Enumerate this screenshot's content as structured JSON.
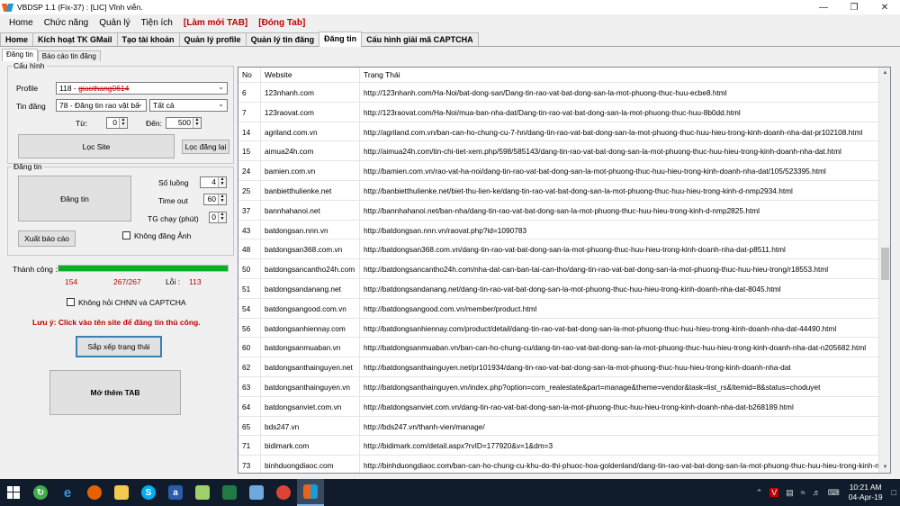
{
  "window": {
    "title": "VBDSP 1.1 (Fix-37) : [LIC] Vĩnh viễn."
  },
  "menu": [
    "Home",
    "Chức năng",
    "Quản lý",
    "Tiện ích"
  ],
  "menu_red": [
    "[Làm mới TAB]",
    "[Đóng Tab]"
  ],
  "top_tabs": [
    "Home",
    "Kích hoạt TK GMail",
    "Tạo tài khoản",
    "Quản lý profile",
    "Quản lý tin đăng",
    "Đăng tin",
    "Cấu hình giải mã CAPTCHA"
  ],
  "sub_tabs": [
    "Đăng tin",
    "Báo cáo tin đăng"
  ],
  "config": {
    "legend": "Cấu hình",
    "profile_label": "Profile",
    "profile_id": "118 -",
    "profile_name": "giaothang0614",
    "tin_dang_label": "Tin đăng",
    "tin_dang_value": "78 - Đăng tin rao vặt bấ",
    "filter_value": "Tất cả",
    "tu_label": "Từ:",
    "tu_value": "0",
    "den_label": "Đến:",
    "den_value": "500",
    "loc_site": "Lọc Site",
    "loc_dang_lai": "Lọc đăng lại"
  },
  "post": {
    "legend": "Đăng tin",
    "button": "Đăng tin",
    "so_luong_label": "Số luồng",
    "so_luong": "4",
    "timeout_label": "Time out",
    "timeout": "60",
    "tg_chay_label": "TG chạy (phút)",
    "tg_chay": "0",
    "xuat_bao_cao": "Xuất báo cáo",
    "khong_dang_anh": "Không đăng Ảnh"
  },
  "status": {
    "thanh_cong_label": "Thành công :",
    "progress": 1.0,
    "success": "154",
    "count": "267/267",
    "loi_label": "Lỗi :",
    "loi": "113",
    "khong_hoi": "Không hỏi CHNN và CAPTCHA",
    "luu_y": "Lưu ý: Click vào tên site để đăng tin thủ công.",
    "sap_xep": "Sắp xếp trạng thái",
    "mo_them_tab": "Mở thêm TAB"
  },
  "grid": {
    "columns": [
      "No",
      "Website",
      "Trạng Thái"
    ],
    "rows": [
      [
        "6",
        "123nhanh.com",
        "http://123nhanh.com/Ha-Noi/bat-dong-san/Dang-tin-rao-vat-bat-dong-san-la-mot-phuong-thuc-huu-ecbe8.html"
      ],
      [
        "7",
        "123raovat.com",
        "http://123raovat.com/Ha-Noi/mua-ban-nha-dat/Dang-tin-rao-vat-bat-dong-san-la-mot-phuong-thuc-huu-8b0dd.html"
      ],
      [
        "14",
        "agriland.com.vn",
        "http://agriland.com.vn/ban-can-ho-chung-cu-7-hn/dang-tin-rao-vat-bat-dong-san-la-mot-phuong-thuc-huu-hieu-trong-kinh-doanh-nha-dat-pr102108.html"
      ],
      [
        "15",
        "aimua24h.com",
        "http://aimua24h.com/tin-chi-tiet-xem.php/598/585143/dang-tin-rao-vat-bat-dong-san-la-mot-phuong-thuc-huu-hieu-trong-kinh-doanh-nha-dat.html"
      ],
      [
        "24",
        "bamien.com.vn",
        "http://bamien.com.vn/rao-vat-ha-noi/dang-tin-rao-vat-bat-dong-san-la-mot-phuong-thuc-huu-hieu-trong-kinh-doanh-nha-dat/105/523395.html"
      ],
      [
        "25",
        "banbietthulienke.net",
        "http://banbietthulienke.net/biet-thu-lien-ke/dang-tin-rao-vat-bat-dong-san-la-mot-phuong-thuc-huu-hieu-trong-kinh-d-nmp2934.html"
      ],
      [
        "37",
        "bannhahanoi.net",
        "http://bannhahanoi.net/ban-nha/dang-tin-rao-vat-bat-dong-san-la-mot-phuong-thuc-huu-hieu-trong-kinh-d-nmp2825.html"
      ],
      [
        "43",
        "batdongsan.nnn.vn",
        "http://batdongsan.nnn.vn/raovat.php?id=1090783"
      ],
      [
        "48",
        "batdongsan368.com.vn",
        "http://batdongsan368.com.vn/dang-tin-rao-vat-bat-dong-san-la-mot-phuong-thuc-huu-hieu-trong-kinh-doanh-nha-dat-p8511.html"
      ],
      [
        "50",
        "batdongsancantho24h.com",
        "http://batdongsancantho24h.com/nha-dat-can-ban-tai-can-tho/dang-tin-rao-vat-bat-dong-san-la-mot-phuong-thuc-huu-hieu-trong/r18553.html"
      ],
      [
        "51",
        "batdongsandanang.net",
        "http://batdongsandanang.net/dang-tin-rao-vat-bat-dong-san-la-mot-phuong-thuc-huu-hieu-trong-kinh-doanh-nha-dat-8045.html"
      ],
      [
        "54",
        "batdongsangood.com.vn",
        "http://batdongsangood.com.vn/member/product.html"
      ],
      [
        "56",
        "batdongsanhiennay.com",
        "http://batdongsanhiennay.com/product/detail/dang-tin-rao-vat-bat-dong-san-la-mot-phuong-thuc-huu-hieu-trong-kinh-doanh-nha-dat-44490.html"
      ],
      [
        "60",
        "batdongsanmuaban.vn",
        "http://batdongsanmuaban.vn/ban-can-ho-chung-cu/dang-tin-rao-vat-bat-dong-san-la-mot-phuong-thuc-huu-hieu-trong-kinh-doanh-nha-dat-n205682.html"
      ],
      [
        "62",
        "batdongsanthainguyen.net",
        "http://batdongsanthainguyen.net/pr101934/dang-tin-rao-vat-bat-dong-san-la-mot-phuong-thuc-huu-hieu-trong-kinh-doanh-nha-dat"
      ],
      [
        "63",
        "batdongsanthainguyen.vn",
        "http://batdongsanthainguyen.vn/index.php?option=com_realestate&part=manage&theme=vendor&task=list_rs&Itemid=8&status=choduyet"
      ],
      [
        "64",
        "batdongsanviet.com.vn",
        "http://batdongsanviet.com.vn/dang-tin-rao-vat-bat-dong-san-la-mot-phuong-thuc-huu-hieu-trong-kinh-doanh-nha-dat-b268189.html"
      ],
      [
        "65",
        "bds247.vn",
        "http://bds247.vn/thanh-vien/manage/"
      ],
      [
        "71",
        "bidimark.com",
        "http://bidimark.com/detail.aspx?rvID=177920&v=1&dm=3"
      ],
      [
        "73",
        "binhduongdiaoc.com",
        "http://binhduongdiaoc.com/ban-can-ho-chung-cu-khu-do-thi-phuoc-hoa-goldenland/dang-tin-rao-vat-bat-dong-san-la-mot-phuong-thuc-huu-hieu-trong-kinh-n..."
      ]
    ]
  },
  "taskbar": {
    "time": "10:21 AM",
    "date": "04-Apr-19"
  },
  "colors": {
    "accent_red": "#c00000",
    "progress_green": "#06b025",
    "taskbar": "#101c2c"
  }
}
